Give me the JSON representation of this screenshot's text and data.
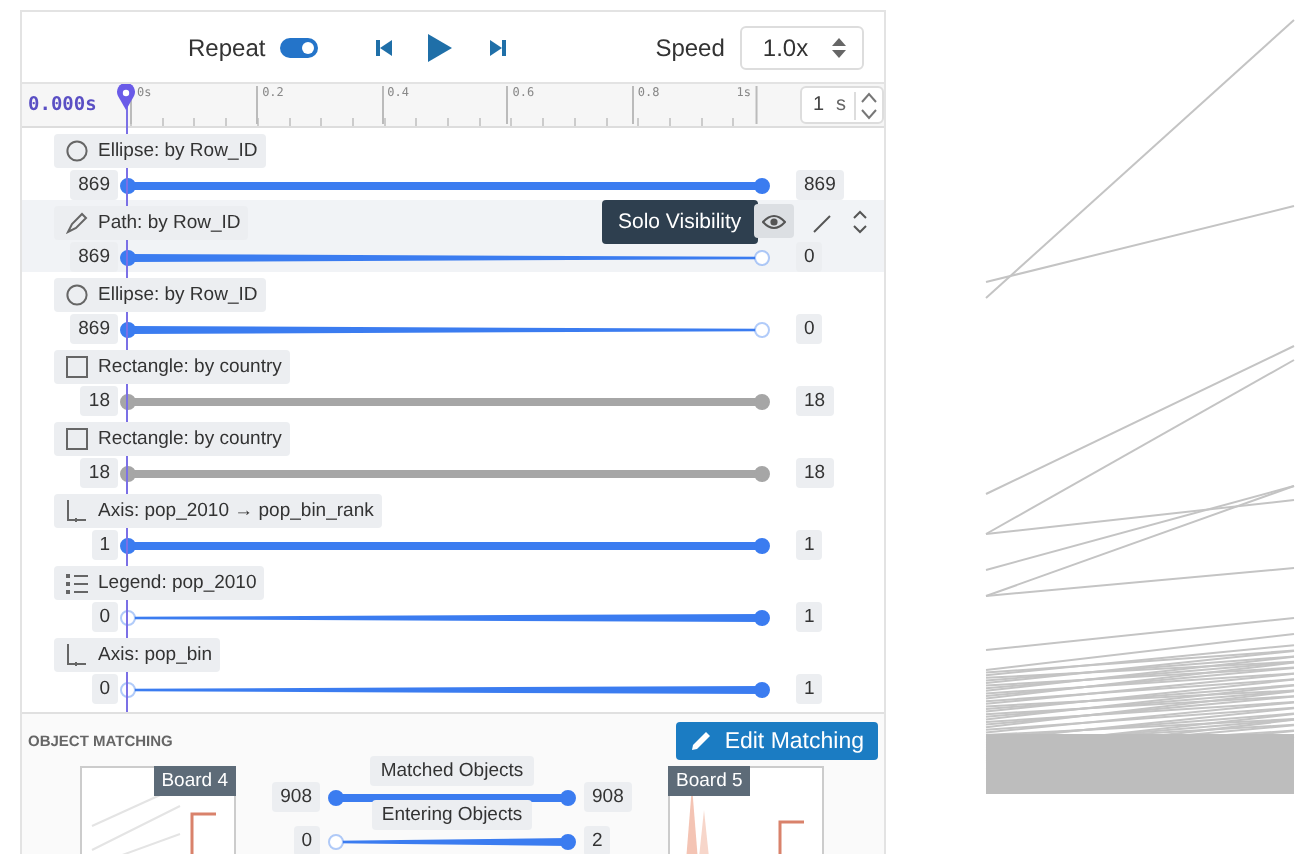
{
  "toolbar": {
    "repeat_label": "Repeat",
    "repeat_on": true,
    "speed_label": "Speed",
    "speed_value": "1.0x"
  },
  "timeline": {
    "current_time": "0.000s",
    "ticks": [
      "0s",
      "0.2",
      "0.4",
      "0.6",
      "0.8",
      "1s"
    ],
    "duration_value": "1",
    "duration_unit": "s"
  },
  "tracks": [
    {
      "kind": "ellipse",
      "label": "Ellipse: by Row_ID",
      "start_value": "869",
      "end_value": "869",
      "start_visible": true,
      "end_visible": true,
      "color": "#3b7cf0",
      "selected": false
    },
    {
      "kind": "path",
      "label": "Path: by Row_ID",
      "start_value": "869",
      "end_value": "0",
      "start_visible": true,
      "end_visible": false,
      "color": "#3b7cf0",
      "selected": true,
      "tooltip": "Solo Visibility"
    },
    {
      "kind": "ellipse",
      "label": "Ellipse: by Row_ID",
      "start_value": "869",
      "end_value": "0",
      "start_visible": true,
      "end_visible": false,
      "color": "#3b7cf0",
      "selected": false
    },
    {
      "kind": "rectangle",
      "label": "Rectangle: by country",
      "start_value": "18",
      "end_value": "18",
      "start_visible": true,
      "end_visible": true,
      "color": "#a6a6a6",
      "selected": false
    },
    {
      "kind": "rectangle",
      "label": "Rectangle: by country",
      "start_value": "18",
      "end_value": "18",
      "start_visible": true,
      "end_visible": true,
      "color": "#a6a6a6",
      "selected": false
    },
    {
      "kind": "axis",
      "label": "Axis: pop_2010 → pop_bin_rank",
      "start_value": "1",
      "end_value": "1",
      "start_visible": true,
      "end_visible": true,
      "color": "#3b7cf0",
      "selected": false
    },
    {
      "kind": "legend",
      "label": "Legend: pop_2010",
      "start_value": "0",
      "end_value": "1",
      "start_visible": false,
      "end_visible": true,
      "color": "#3b7cf0",
      "selected": false
    },
    {
      "kind": "axis",
      "label": "Axis: pop_bin",
      "start_value": "0",
      "end_value": "1",
      "start_visible": false,
      "end_visible": true,
      "color": "#3b7cf0",
      "selected": false
    }
  ],
  "object_matching": {
    "heading": "OBJECT MATCHING",
    "edit_button": "Edit Matching",
    "from_board": "Board 4",
    "to_board": "Board 5",
    "rows": [
      {
        "label": "Matched Objects",
        "start_value": "908",
        "end_value": "908",
        "start_visible": true,
        "end_visible": true
      },
      {
        "label": "Entering Objects",
        "start_value": "0",
        "end_value": "2",
        "start_visible": false,
        "end_visible": true
      }
    ]
  }
}
